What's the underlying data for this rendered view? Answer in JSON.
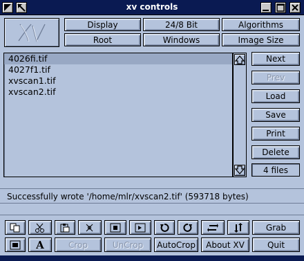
{
  "window": {
    "title": "xv controls"
  },
  "logo": {
    "text": "XV"
  },
  "top_buttons": {
    "display": "Display",
    "bit_depth": "24/8 Bit",
    "algorithms": "Algorithms",
    "root": "Root",
    "windows": "Windows",
    "image_size": "Image Size"
  },
  "file_list": {
    "items": [
      "4026fi.tif",
      "4027f1.tif",
      "xvscan1.tif",
      "xvscan2.tif"
    ],
    "selected_index": 0
  },
  "side_buttons": {
    "next": "Next",
    "prev": "Prev",
    "load": "Load",
    "save": "Save",
    "print": "Print",
    "delete": "Delete"
  },
  "file_count": "4 files",
  "status": "Successfully wrote '/home/mlr/xvscan2.tif'  (593718 bytes)",
  "bottom_buttons": {
    "grab": "Grab",
    "crop": "Crop",
    "uncrop": "UnCrop",
    "autocrop": "AutoCrop",
    "about": "About XV",
    "quit": "Quit",
    "text_tool": "A"
  },
  "icons": {
    "copy": "copy-icon",
    "cut": "scissors-icon",
    "paste": "paste-icon",
    "clear": "clear-icon",
    "pad": "pad-icon",
    "annotate": "annotate-icon",
    "rotate_left": "rotate-ccw-icon",
    "rotate_right": "rotate-cw-icon",
    "flip_h": "flip-horizontal-icon",
    "flip_v": "flip-vertical-icon",
    "info": "info-icon",
    "text": "text-icon"
  },
  "colors": {
    "titlebar": "#0a1a52",
    "background": "#b4c3dc",
    "selection": "#98a8c4"
  }
}
